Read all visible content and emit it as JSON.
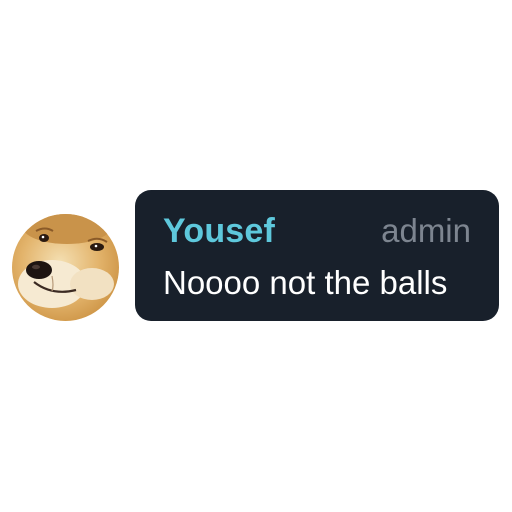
{
  "message": {
    "author": "Yousef",
    "role": "admin",
    "text": "Noooo not the balls",
    "avatar_icon": "doge-avatar-icon"
  },
  "colors": {
    "bubble_bg": "#18202b",
    "author_name": "#5ec8dc",
    "role_text": "#7d8590",
    "message_text": "#ffffff"
  }
}
